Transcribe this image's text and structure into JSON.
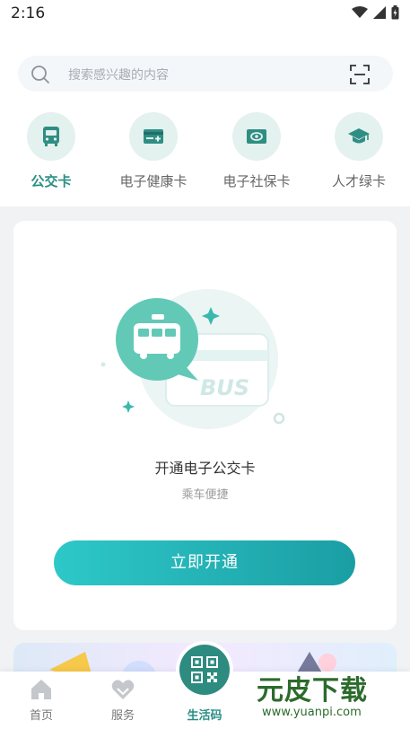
{
  "status": {
    "time": "2:16"
  },
  "search": {
    "placeholder": "搜索感兴趣的内容"
  },
  "quick_access": [
    {
      "label": "公交卡",
      "icon": "bus-icon",
      "active": true
    },
    {
      "label": "电子健康卡",
      "icon": "health-card-icon",
      "active": false
    },
    {
      "label": "电子社保卡",
      "icon": "social-security-card-icon",
      "active": false
    },
    {
      "label": "人才绿卡",
      "icon": "graduation-cap-icon",
      "active": false
    }
  ],
  "card": {
    "illustration_text": "BUS",
    "title": "开通电子公交卡",
    "subtitle": "乘车便捷",
    "button_label": "立即开通"
  },
  "tabbar": [
    {
      "label": "首页",
      "icon": "home-icon"
    },
    {
      "label": "服务",
      "icon": "heart-hands-icon"
    },
    {
      "label": "生活码",
      "icon": "qr-code-icon"
    }
  ],
  "watermark": {
    "brand": "元皮下载",
    "url": "www.yuanpi.com"
  },
  "colors": {
    "accent": "#2a8f84",
    "button_start": "#2ec8c8",
    "button_end": "#1a9ea4"
  }
}
